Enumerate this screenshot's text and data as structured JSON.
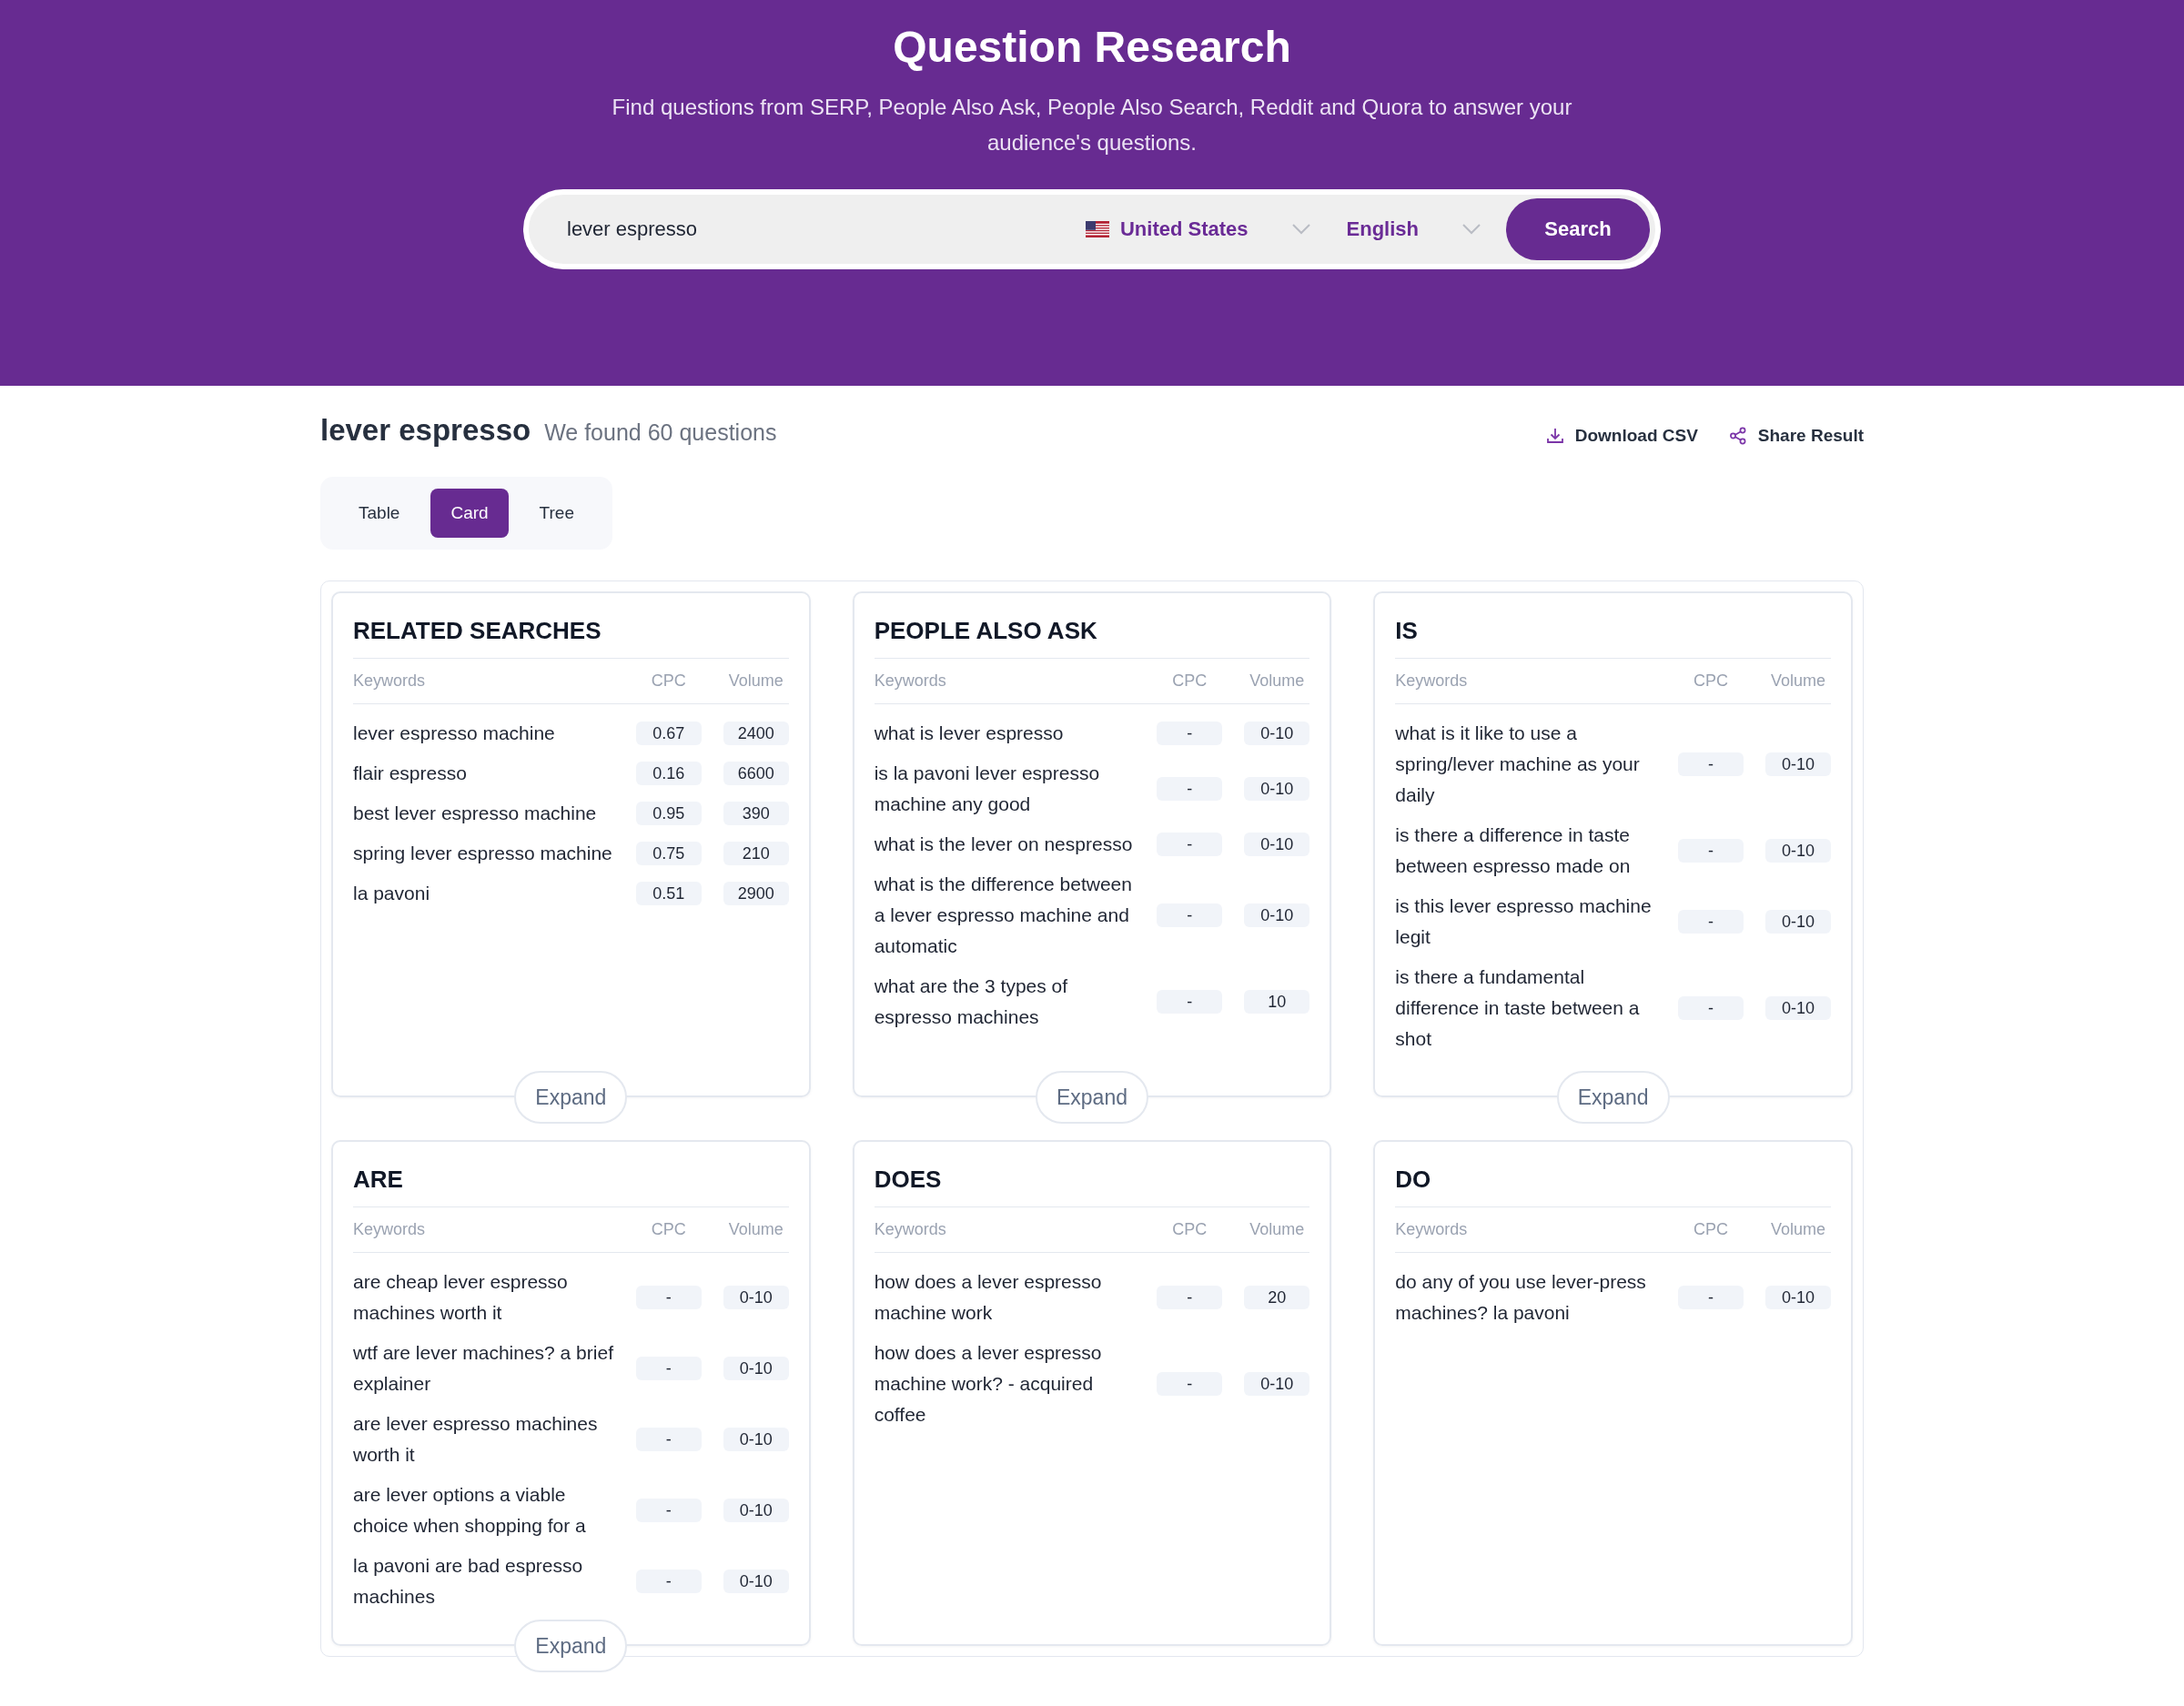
{
  "header": {
    "title": "Question Research",
    "subtitle": "Find questions from SERP, People Also Ask, People Also Search, Reddit and Quora to answer your audience's questions."
  },
  "search": {
    "value": "lever espresso",
    "country": "United States",
    "language": "English",
    "button": "Search"
  },
  "results": {
    "query": "lever espresso",
    "summary": "We found 60 questions",
    "actions": [
      "Download CSV",
      "Share Result"
    ]
  },
  "view_tabs": [
    {
      "label": "Table",
      "selected": false
    },
    {
      "label": "Card",
      "selected": true
    },
    {
      "label": "Tree",
      "selected": false
    }
  ],
  "cards": [
    {
      "title": "RELATED SEARCHES",
      "columns": [
        "Keywords",
        "CPC",
        "Volume"
      ],
      "expand": "Expand",
      "rows": [
        {
          "keyword": "lever espresso machine",
          "cpc": "0.67",
          "volume": "2400"
        },
        {
          "keyword": "flair espresso",
          "cpc": "0.16",
          "volume": "6600"
        },
        {
          "keyword": "best lever espresso machine",
          "cpc": "0.95",
          "volume": "390"
        },
        {
          "keyword": "spring lever espresso machine",
          "cpc": "0.75",
          "volume": "210"
        },
        {
          "keyword": "la pavoni",
          "cpc": "0.51",
          "volume": "2900"
        }
      ]
    },
    {
      "title": "PEOPLE ALSO ASK",
      "columns": [
        "Keywords",
        "CPC",
        "Volume"
      ],
      "expand": "Expand",
      "rows": [
        {
          "keyword": "what is lever espresso",
          "cpc": "-",
          "volume": "0-10"
        },
        {
          "keyword": "is la pavoni lever espresso machine any good",
          "cpc": "-",
          "volume": "0-10"
        },
        {
          "keyword": "what is the lever on nespresso",
          "cpc": "-",
          "volume": "0-10"
        },
        {
          "keyword": "what is the difference between a lever espresso machine and automatic",
          "cpc": "-",
          "volume": "0-10"
        },
        {
          "keyword": "what are the 3 types of espresso machines",
          "cpc": "-",
          "volume": "10"
        }
      ]
    },
    {
      "title": "IS",
      "columns": [
        "Keywords",
        "CPC",
        "Volume"
      ],
      "expand": "Expand",
      "rows": [
        {
          "keyword": "what is it like to use a spring/lever machine as your daily",
          "cpc": "-",
          "volume": "0-10"
        },
        {
          "keyword": "is there a difference in taste between espresso made on",
          "cpc": "-",
          "volume": "0-10"
        },
        {
          "keyword": "is this lever espresso machine legit",
          "cpc": "-",
          "volume": "0-10"
        },
        {
          "keyword": "is there a fundamental difference in taste between a shot",
          "cpc": "-",
          "volume": "0-10"
        }
      ]
    },
    {
      "title": "ARE",
      "columns": [
        "Keywords",
        "CPC",
        "Volume"
      ],
      "expand": "Expand",
      "rows": [
        {
          "keyword": "are cheap lever espresso machines worth it",
          "cpc": "-",
          "volume": "0-10"
        },
        {
          "keyword": "wtf are lever machines? a brief explainer",
          "cpc": "-",
          "volume": "0-10"
        },
        {
          "keyword": "are lever espresso machines worth it",
          "cpc": "-",
          "volume": "0-10"
        },
        {
          "keyword": "are lever options a viable choice when shopping for a",
          "cpc": "-",
          "volume": "0-10"
        },
        {
          "keyword": "la pavoni are bad espresso machines",
          "cpc": "-",
          "volume": "0-10"
        }
      ]
    },
    {
      "title": "DOES",
      "columns": [
        "Keywords",
        "CPC",
        "Volume"
      ],
      "rows": [
        {
          "keyword": "how does a lever espresso machine work",
          "cpc": "-",
          "volume": "20"
        },
        {
          "keyword": "how does a lever espresso machine work? - acquired coffee",
          "cpc": "-",
          "volume": "0-10"
        }
      ]
    },
    {
      "title": "DO",
      "columns": [
        "Keywords",
        "CPC",
        "Volume"
      ],
      "rows": [
        {
          "keyword": "do any of you use lever-press machines? la pavoni",
          "cpc": "-",
          "volume": "0-10"
        }
      ]
    }
  ]
}
